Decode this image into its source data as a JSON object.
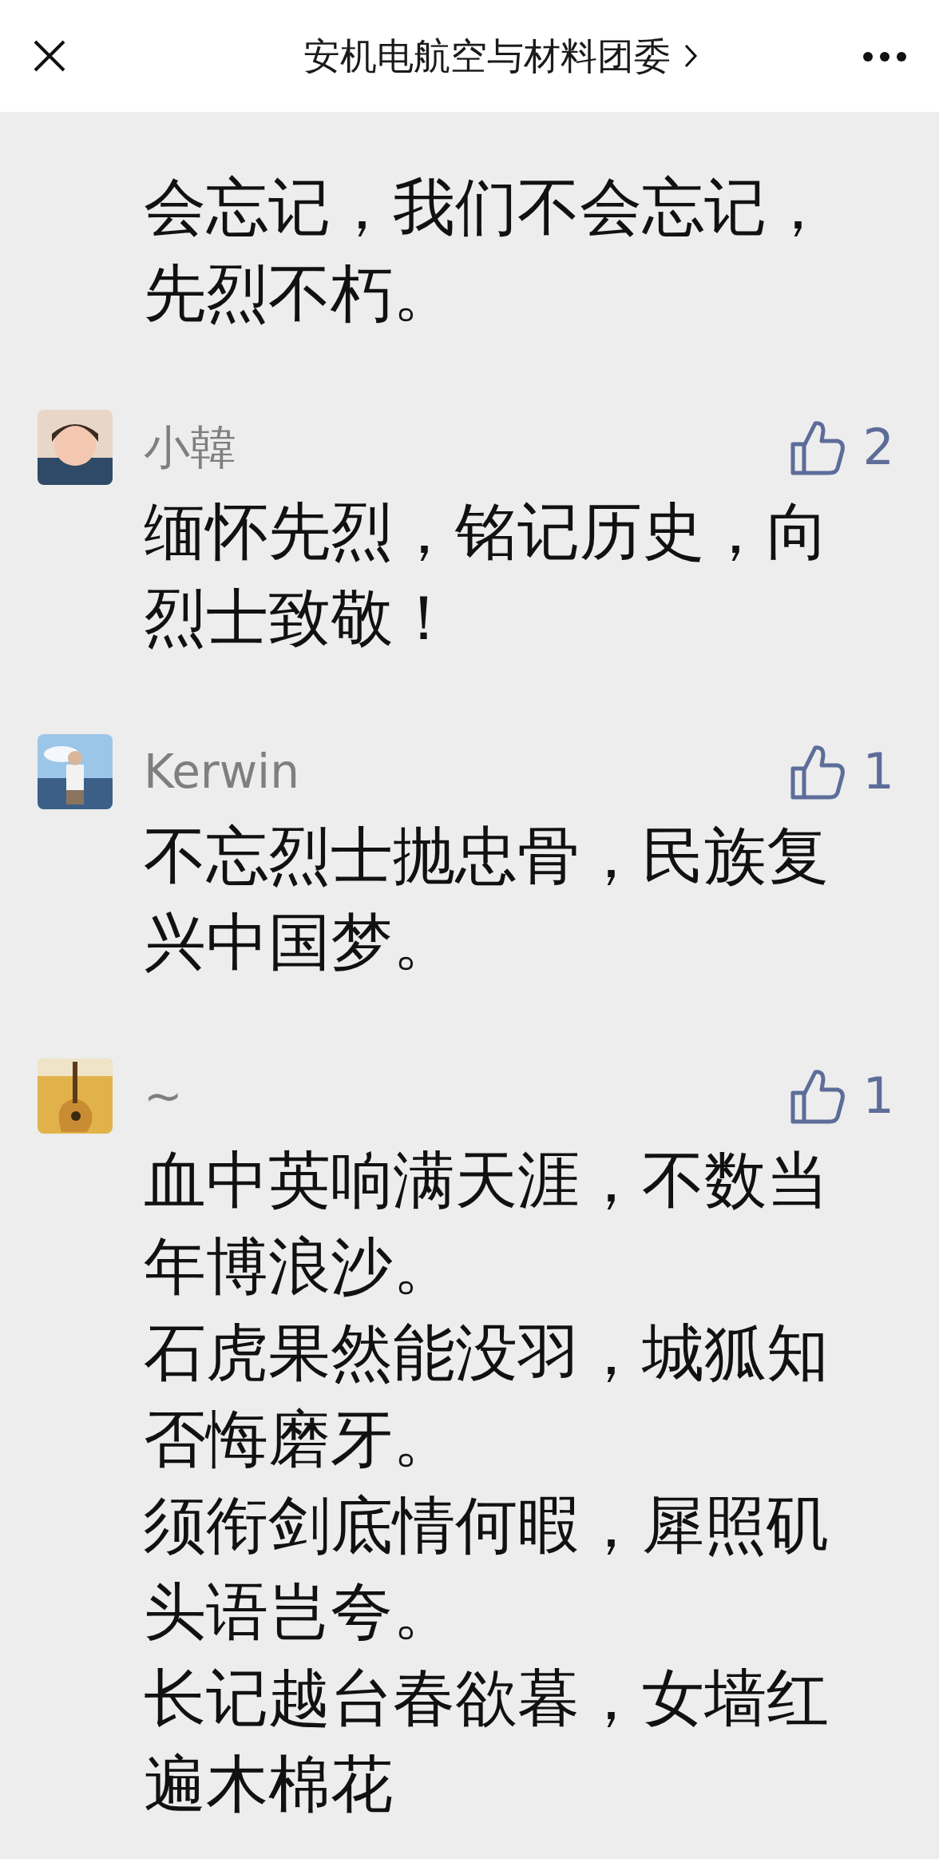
{
  "header": {
    "title": "安机电航空与材料团委"
  },
  "comments": [
    {
      "lines": [
        "会忘记，我们不会忘记，先烈不朽。"
      ]
    },
    {
      "name": "小韓",
      "lines": [
        "缅怀先烈，铭记历史，向烈士致敬！"
      ],
      "likes": "2"
    },
    {
      "name": "Kerwin",
      "lines": [
        "不忘烈士抛忠骨，民族复兴中国梦。"
      ],
      "likes": "1"
    },
    {
      "name": "~",
      "lines": [
        "血中英响满天涯，不数当年博浪沙。",
        "石虎果然能没羽，城狐知否悔磨牙。",
        "须衔剑底情何暇，犀照矶头语岂夸。",
        "长记越台春欲暮，女墙红遍木棉花"
      ],
      "likes": "1"
    }
  ]
}
